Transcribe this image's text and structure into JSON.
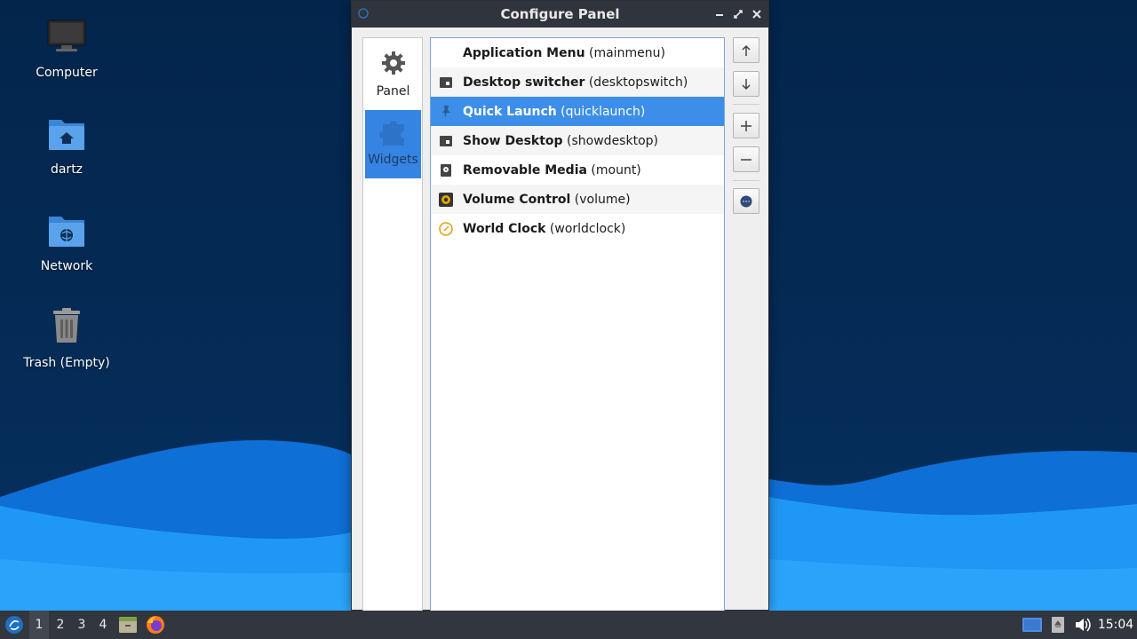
{
  "desktop": {
    "icons": [
      {
        "label": "Computer",
        "icon": "computer-icon"
      },
      {
        "label": "dartz",
        "icon": "home-folder-icon"
      },
      {
        "label": "Network",
        "icon": "network-folder-icon"
      },
      {
        "label": "Trash (Empty)",
        "icon": "trash-icon"
      }
    ]
  },
  "window": {
    "title": "Configure Panel",
    "controls": {
      "minimize": "minimize-icon",
      "maximize": "maximize-icon",
      "close": "close-icon"
    },
    "sidebar": {
      "items": [
        {
          "label": "Panel",
          "icon": "gear-icon",
          "active": false
        },
        {
          "label": "Widgets",
          "icon": "puzzle-icon",
          "active": true
        }
      ]
    },
    "widgets": [
      {
        "name": "Application Menu",
        "id": "(mainmenu)",
        "icon": "none"
      },
      {
        "name": "Desktop switcher",
        "id": "(desktopswitch)",
        "icon": "window-icon"
      },
      {
        "name": "Quick Launch",
        "id": "(quicklaunch)",
        "icon": "pin-icon",
        "selected": true
      },
      {
        "name": "Show Desktop",
        "id": "(showdesktop)",
        "icon": "window-icon"
      },
      {
        "name": "Removable Media",
        "id": "(mount)",
        "icon": "drive-icon"
      },
      {
        "name": "Volume Control",
        "id": "(volume)",
        "icon": "speaker-icon"
      },
      {
        "name": "World Clock",
        "id": "(worldclock)",
        "icon": "clock-icon"
      }
    ],
    "toolbar": [
      "move-up-icon",
      "move-down-icon",
      "add-icon",
      "remove-icon",
      "configure-icon"
    ]
  },
  "taskbar": {
    "workspaces": [
      "1",
      "2",
      "3",
      "4"
    ],
    "active_workspace": "1",
    "clock": "15:04"
  },
  "colors": {
    "desktop_bg": "#03254c",
    "wave_light": "#1a8cf0",
    "selection": "#3d8ee8",
    "titlebar": "#30343c",
    "taskbar": "#32363e"
  }
}
